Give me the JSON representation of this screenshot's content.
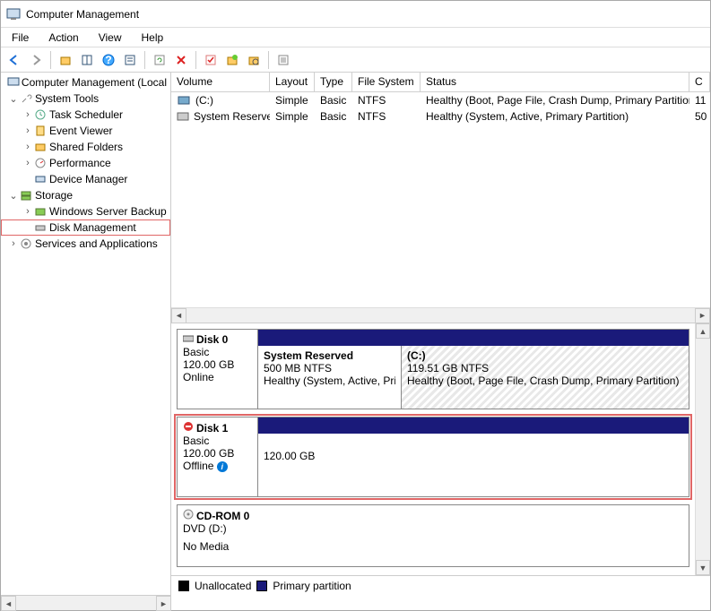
{
  "window": {
    "title": "Computer Management"
  },
  "menu": {
    "file": "File",
    "action": "Action",
    "view": "View",
    "help": "Help"
  },
  "tree": {
    "root": "Computer Management (Local",
    "systools": "System Tools",
    "st_items": [
      "Task Scheduler",
      "Event Viewer",
      "Shared Folders",
      "Performance",
      "Device Manager"
    ],
    "storage": "Storage",
    "storage_items": [
      "Windows Server Backup",
      "Disk Management"
    ],
    "services": "Services and Applications"
  },
  "vol_headers": {
    "volume": "Volume",
    "layout": "Layout",
    "type": "Type",
    "fs": "File System",
    "status": "Status",
    "c": "C"
  },
  "volumes": [
    {
      "name": "(C:)",
      "layout": "Simple",
      "type": "Basic",
      "fs": "NTFS",
      "status": "Healthy (Boot, Page File, Crash Dump, Primary Partition)",
      "c": "11"
    },
    {
      "name": "System Reserved",
      "layout": "Simple",
      "type": "Basic",
      "fs": "NTFS",
      "status": "Healthy (System, Active, Primary Partition)",
      "c": "50"
    }
  ],
  "disks": {
    "d0": {
      "name": "Disk 0",
      "type": "Basic",
      "size": "120.00 GB",
      "state": "Online"
    },
    "d0p0": {
      "name": "System Reserved",
      "size": "500 MB NTFS",
      "status": "Healthy (System, Active, Primary Partition)"
    },
    "d0p1": {
      "name": "(C:)",
      "size": "119.51 GB NTFS",
      "status": "Healthy (Boot, Page File, Crash Dump, Primary Partition)"
    },
    "d1": {
      "name": "Disk 1",
      "type": "Basic",
      "size": "120.00 GB",
      "state": "Offline"
    },
    "d1p0": {
      "size": "120.00 GB"
    },
    "cd": {
      "name": "CD-ROM 0",
      "type": "DVD (D:)",
      "state": "No Media"
    }
  },
  "legend": {
    "unalloc": "Unallocated",
    "primary": "Primary partition"
  }
}
